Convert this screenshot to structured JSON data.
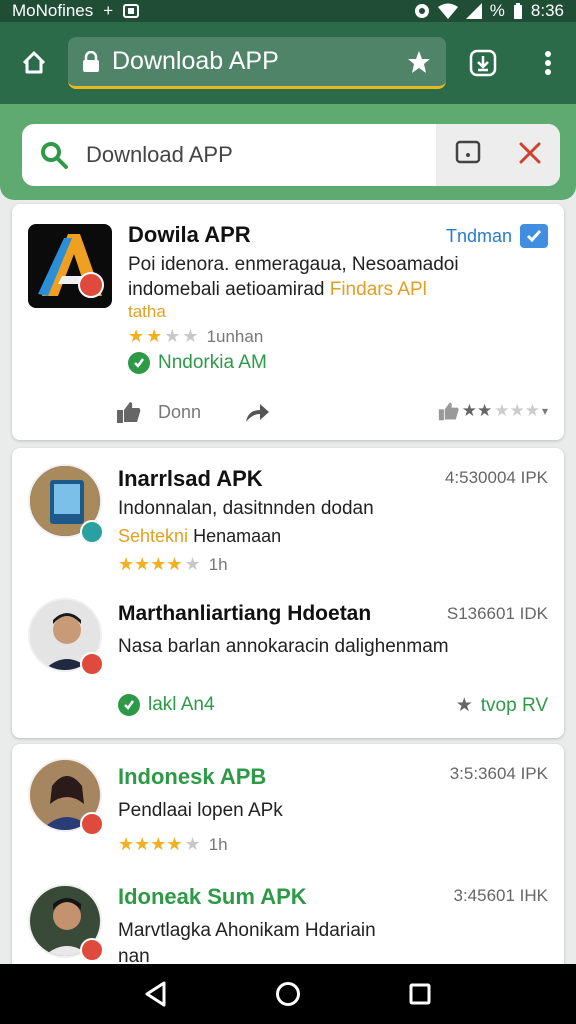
{
  "status_bar": {
    "carrier": "MoNofines",
    "plus": "+",
    "battery_pct": "%",
    "time": "8:36"
  },
  "app_bar": {
    "url": "Downloab APP"
  },
  "search": {
    "value": "Download APP"
  },
  "featured": {
    "title": "Dowila APR",
    "trusted_label": "Tndman",
    "desc_line1": "Poi idenora. enmeragaua, Nesoamadoi",
    "desc_line2_a": "indomebali aetioamirad ",
    "desc_line2_b": "Findars APl",
    "desc_line3": "tatha",
    "rating_value": 2.5,
    "rating_text": "1unhan",
    "verified_text": "Nndorkia AM",
    "like_label": "Donn"
  },
  "results": [
    {
      "title": "Inarrlsad APK",
      "price": "4:530004 IPK",
      "line1": "Indonnalan, dasitnnden dodan",
      "tag": "Sehtekni",
      "tag2": "Henamaan",
      "rating_value": 4.5,
      "rating_text": "1h"
    },
    {
      "title": "Marthanliartiang Hdoetan",
      "price": "S136601 IDK",
      "line1": "Nasa barlan annokaracin dalighenmam",
      "verified_text": "lakl An4",
      "tag_right": "tvop RV"
    },
    {
      "title": "Indonesk APB",
      "price": "3:5:3604 IPK",
      "line1": "Pendlaai lopen APk",
      "rating_value": 4,
      "rating_text": "1h"
    },
    {
      "title": "Idoneak Sum APK",
      "price": "3:45601 IHK",
      "line1": "Marvtlagka Ahonikam Hdariain",
      "line2": "nan"
    }
  ],
  "colors": {
    "app_bar": "#2c6b4a",
    "search_area": "#5faa70",
    "accent_green": "#2e9a48",
    "star": "#f0b020",
    "orange": "#e0a020",
    "blue": "#3f8ee0"
  },
  "icons": [
    "home-icon",
    "lock-icon",
    "star-icon",
    "download-tab-icon",
    "more-vert-icon",
    "search-icon",
    "comment-icon",
    "close-icon",
    "thumbs-up-icon",
    "share-icon",
    "back-icon",
    "home-circle-icon",
    "recents-icon"
  ]
}
